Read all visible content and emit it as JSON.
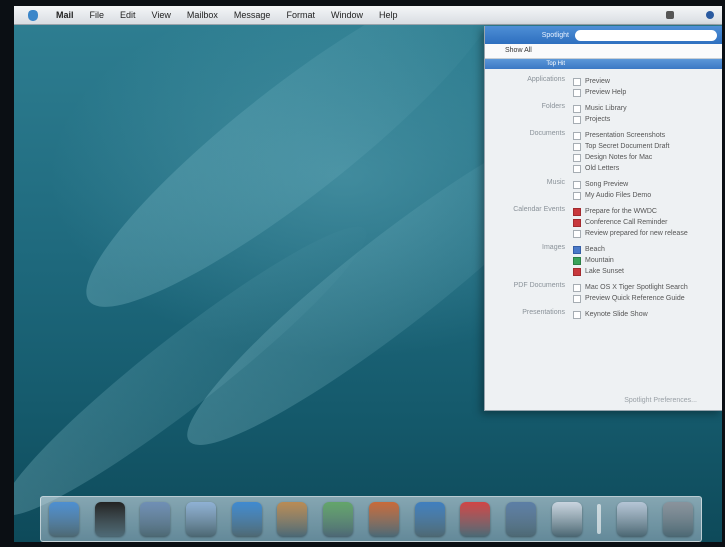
{
  "menubar": {
    "items": [
      "Mail",
      "File",
      "Edit",
      "View",
      "Mailbox",
      "Message",
      "Format",
      "Window",
      "Help"
    ],
    "clock": ""
  },
  "panel": {
    "search_label": "Spotlight",
    "search_value": "",
    "show_all_label": "Show All",
    "top_hit_label": "Top Hit",
    "groups": [
      {
        "label": "Applications",
        "items": [
          {
            "text": "Preview",
            "mark": "none"
          },
          {
            "text": "Preview Help",
            "mark": "none"
          }
        ]
      },
      {
        "label": "Folders",
        "items": [
          {
            "text": "Music Library",
            "mark": "none"
          },
          {
            "text": "Projects",
            "mark": "none"
          }
        ]
      },
      {
        "label": "Documents",
        "items": [
          {
            "text": "Presentation Screenshots",
            "mark": "none"
          },
          {
            "text": "Top Secret Document Draft",
            "mark": "none"
          },
          {
            "text": "Design Notes for Mac",
            "mark": "none"
          },
          {
            "text": "Old Letters",
            "mark": "none"
          }
        ]
      },
      {
        "label": "Music",
        "items": [
          {
            "text": "Song Preview",
            "mark": "none"
          },
          {
            "text": "My Audio Files Demo",
            "mark": "none"
          }
        ]
      },
      {
        "label": "Calendar Events",
        "items": [
          {
            "text": "Prepare for the WWDC",
            "mark": "red"
          },
          {
            "text": "Conference Call Reminder",
            "mark": "red"
          },
          {
            "text": "Review prepared for new release",
            "mark": "none"
          }
        ]
      },
      {
        "label": "Images",
        "items": [
          {
            "text": "Beach",
            "mark": "blue"
          },
          {
            "text": "Mountain",
            "mark": "green"
          },
          {
            "text": "Lake Sunset",
            "mark": "red"
          }
        ]
      },
      {
        "label": "PDF Documents",
        "items": [
          {
            "text": "Mac OS X Tiger Spotlight Search",
            "mark": "none"
          },
          {
            "text": "Preview Quick Reference Guide",
            "mark": "none"
          }
        ]
      },
      {
        "label": "Presentations",
        "items": [
          {
            "text": "Keynote Slide Show",
            "mark": "none"
          }
        ]
      }
    ],
    "footer": "Spotlight Preferences..."
  },
  "dock": {
    "icons": [
      {
        "name": "finder-icon",
        "color": "#4d8fd1"
      },
      {
        "name": "dashboard-icon",
        "color": "#222222"
      },
      {
        "name": "mail-icon",
        "color": "#6f8fb5"
      },
      {
        "name": "ical-icon",
        "color": "#8fb1d4"
      },
      {
        "name": "safari-icon",
        "color": "#3f8ad0"
      },
      {
        "name": "address-book-icon",
        "color": "#b98b54"
      },
      {
        "name": "itunes-icon",
        "color": "#63a56a"
      },
      {
        "name": "ichat-icon",
        "color": "#c86a3a"
      },
      {
        "name": "iphoto-icon",
        "color": "#3f7fbf"
      },
      {
        "name": "calendar-icon",
        "color": "#d04545"
      },
      {
        "name": "system-preferences-icon",
        "color": "#5c7ea6"
      },
      {
        "name": "preview-icon",
        "color": "#c9d4df"
      },
      {
        "name": "spacer",
        "color": "rgba(0,0,0,0)"
      },
      {
        "name": "documents-folder-icon",
        "color": "#b5c5d6"
      },
      {
        "name": "trash-icon",
        "color": "#8a939c"
      }
    ]
  }
}
